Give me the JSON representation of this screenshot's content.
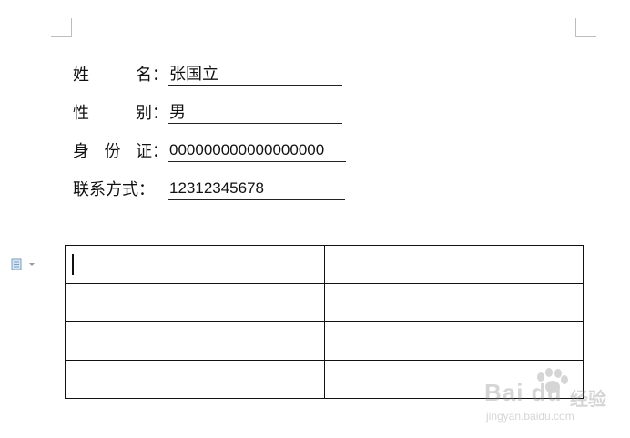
{
  "form": {
    "name": {
      "label_chars": [
        "姓",
        "名："
      ],
      "value": "张国立"
    },
    "gender": {
      "label_chars": [
        "性",
        "别："
      ],
      "value": "男"
    },
    "id_card": {
      "label_chars": [
        "身",
        "份",
        "证："
      ],
      "value": "000000000000000000"
    },
    "contact": {
      "label_chars": [
        "联系方式："
      ],
      "value": "12312345678"
    }
  },
  "table": {
    "rows": 4,
    "cols": 2,
    "cells": [
      [
        "",
        ""
      ],
      [
        "",
        ""
      ],
      [
        "",
        ""
      ],
      [
        "",
        ""
      ]
    ]
  },
  "icons": {
    "paste_options": "paste-options-icon"
  },
  "watermark": {
    "brand": "Bai du",
    "brand_cn": "经验",
    "url": "jingyan.baidu.com"
  },
  "colors": {
    "text": "#111111",
    "border": "#111111",
    "corner_marks": "#bdbdbd",
    "watermark": "#8a8a8a"
  }
}
